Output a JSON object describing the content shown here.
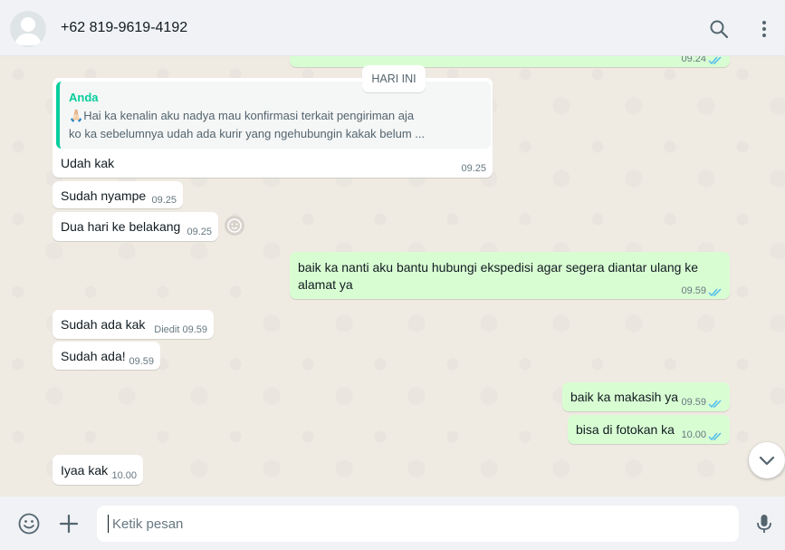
{
  "header": {
    "title": "+62 819-9619-4192",
    "icons": [
      "search-icon",
      "menu-dots-icon"
    ]
  },
  "chat": {
    "top_partial_time": "09.24",
    "date_divider": "HARI INI",
    "quote": {
      "author": "Anda",
      "emoji": "🙏🏻",
      "line1": "Hai ka kenalin aku nadya mau konfirmasi terkait pengiriman aja",
      "line2": "ko ka sebelumnya udah ada kurir yang ngehubungin kakak belum ..."
    },
    "messages": [
      {
        "text": "Udah kak",
        "time": "09.25",
        "dir": "in"
      },
      {
        "text": "Sudah nyampe",
        "time": "09.25",
        "dir": "in"
      },
      {
        "text": "Dua hari ke belakang",
        "time": "09.25",
        "dir": "in"
      },
      {
        "line1": "baik ka nanti aku bantu hubungi ekspedisi agar segera diantar ulang ke",
        "line2": "alamat ya",
        "time": "09.59",
        "dir": "out"
      },
      {
        "text": "Sudah ada kak",
        "time": "Diedit 09.59",
        "dir": "in"
      },
      {
        "text": "Sudah ada!",
        "time": "09.59",
        "dir": "in"
      },
      {
        "text": "baik ka makasih ya",
        "time": "09.59",
        "dir": "out"
      },
      {
        "text": "bisa di fotokan ka",
        "time": "10.00",
        "dir": "out"
      },
      {
        "text": "Iyaa kak",
        "time": "10.00",
        "dir": "in"
      }
    ]
  },
  "composer": {
    "placeholder": "Ketik pesan",
    "icons": [
      "emoji-icon",
      "attach-plus-icon",
      "microphone-icon"
    ]
  },
  "colors": {
    "outgoing": "#d9fdd3",
    "incoming": "#ffffff",
    "accent": "#06cf9c",
    "read_ticks": "#53bdeb",
    "background": "#efeae2"
  }
}
